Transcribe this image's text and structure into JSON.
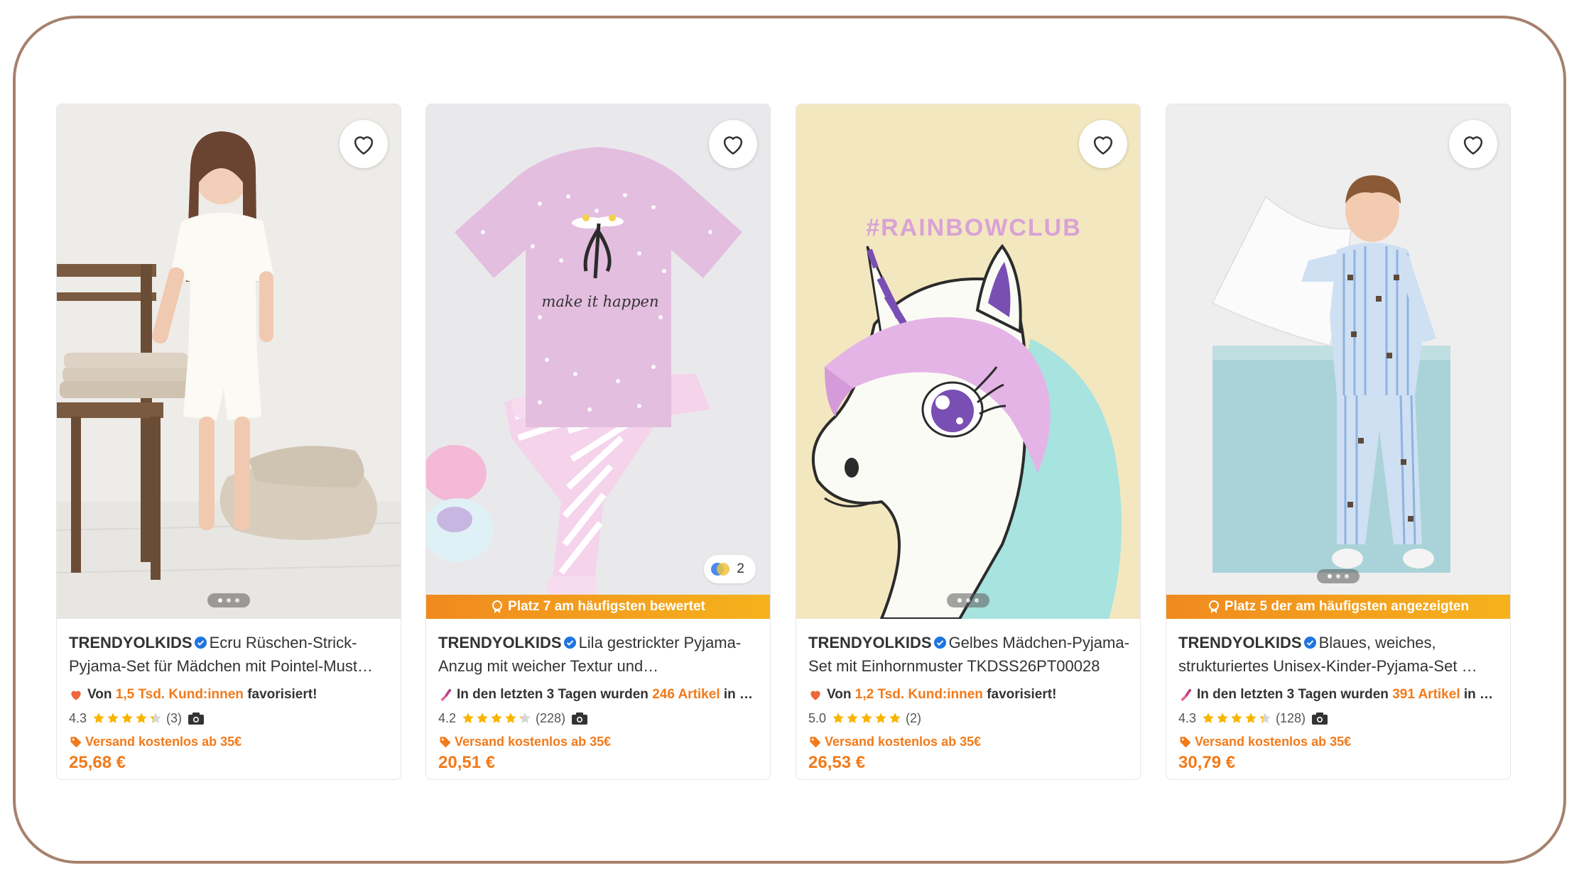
{
  "colors": {
    "accent": "#f27a1a",
    "frame": "#a6816d",
    "star": "#f7b500",
    "verified": "#1f75e0",
    "heart_social": "#f0653b"
  },
  "products": [
    {
      "brand": "TRENDYOLKIDS",
      "title": "Ecru Rüschen-Strick-Pyjama-Set für Mädchen mit Pointel-Must…",
      "social_icon": "heart-icon",
      "social_pre": "Von ",
      "social_hl": "1,5 Tsd. Kund:innen",
      "social_post": " favorisiert!",
      "rating": "4.3",
      "rating_value": 4.3,
      "review_count": "(3)",
      "shipping": "Versand kostenlos ab 35€",
      "price": "25,68 €",
      "banner": "",
      "color_count": ""
    },
    {
      "brand": "TRENDYOLKIDS",
      "title": "Lila gestrickter Pyjama-Anzug mit weicher Textur und…",
      "social_icon": "lipstick-icon",
      "social_pre": "In den letzten 3 Tagen wurden ",
      "social_hl": "246 Artikel",
      "social_post": " in …",
      "rating": "4.2",
      "rating_value": 4.2,
      "review_count": "(228)",
      "shipping": "Versand kostenlos ab 35€",
      "price": "20,51 €",
      "banner": "Platz 7 am häufigsten bewertet",
      "color_count": "2"
    },
    {
      "brand": "TRENDYOLKIDS",
      "title": "Gelbes Mädchen-Pyjama-Set mit Einhornmuster TKDSS26PT00028",
      "social_icon": "heart-icon",
      "social_pre": "Von ",
      "social_hl": "1,2 Tsd. Kund:innen",
      "social_post": " favorisiert!",
      "rating": "5.0",
      "rating_value": 5.0,
      "review_count": "(2)",
      "shipping": "Versand kostenlos ab 35€",
      "price": "26,53 €",
      "banner": "",
      "color_count": "",
      "image_text": "#RAINBOWCLUB"
    },
    {
      "brand": "TRENDYOLKIDS",
      "title": "Blaues, weiches, strukturiertes Unisex-Kinder-Pyjama-Set …",
      "social_icon": "lipstick-icon",
      "social_pre": "In den letzten 3 Tagen wurden ",
      "social_hl": "391 Artikel",
      "social_post": " in …",
      "rating": "4.3",
      "rating_value": 4.3,
      "review_count": "(128)",
      "shipping": "Versand kostenlos ab 35€",
      "price": "30,79 €",
      "banner": "Platz 5 der am häufigsten angezeigten",
      "color_count": ""
    }
  ],
  "t_shirt_print": "make it happen"
}
